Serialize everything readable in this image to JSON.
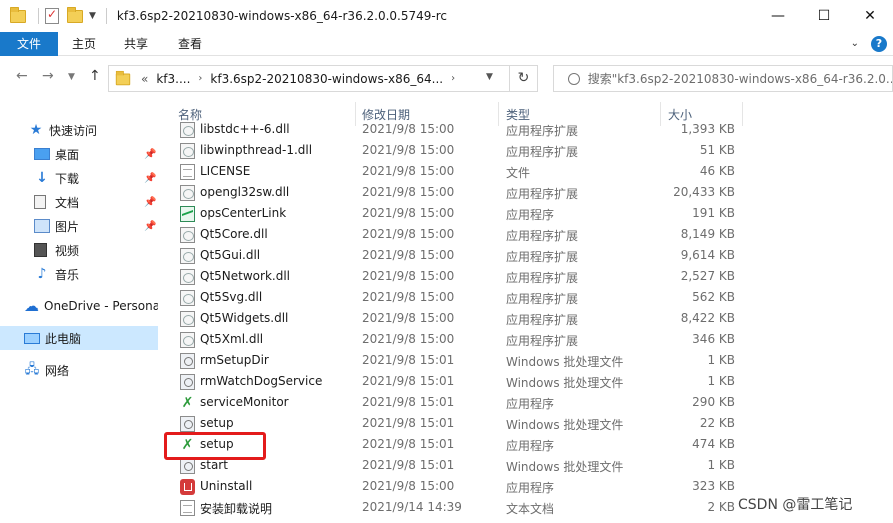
{
  "window": {
    "title": "kf3.6sp2-20210830-windows-x86_64-r36.2.0.0.5749-rc",
    "controls": {
      "minimize": "—",
      "maximize": "☐",
      "close": "✕"
    }
  },
  "ribbon": {
    "file_tab": "文件",
    "tabs": [
      "主页",
      "共享",
      "查看"
    ],
    "help": "?"
  },
  "address_bar": {
    "overflow": "«",
    "crumbs": [
      "kf3....",
      "kf3.6sp2-20210830-windows-x86_64..."
    ],
    "search_placeholder": "搜索\"kf3.6sp2-20210830-windows-x86_64-r36.2.0...."
  },
  "sidebar": {
    "items": [
      {
        "label": "快速访问",
        "icon": "star-icon",
        "pinned": false
      },
      {
        "label": "桌面",
        "icon": "desktop-icon",
        "pinned": true
      },
      {
        "label": "下载",
        "icon": "download-icon",
        "pinned": true
      },
      {
        "label": "文档",
        "icon": "documents-icon",
        "pinned": true
      },
      {
        "label": "图片",
        "icon": "pictures-icon",
        "pinned": true
      },
      {
        "label": "视频",
        "icon": "videos-icon",
        "pinned": false
      },
      {
        "label": "音乐",
        "icon": "music-icon",
        "pinned": false
      },
      {
        "label": "OneDrive - Persona",
        "icon": "onedrive-icon",
        "pinned": false
      },
      {
        "label": "此电脑",
        "icon": "pc-icon",
        "pinned": false,
        "selected": true
      },
      {
        "label": "网络",
        "icon": "network-icon",
        "pinned": false
      }
    ]
  },
  "columns": {
    "name": "名称",
    "date": "修改日期",
    "type": "类型",
    "size": "大小"
  },
  "files": [
    {
      "name": "libstdc++-6.dll",
      "date": "2021/9/8 15:00",
      "type": "应用程序扩展",
      "size": "1,393 KB",
      "icon": "dll"
    },
    {
      "name": "libwinpthread-1.dll",
      "date": "2021/9/8 15:00",
      "type": "应用程序扩展",
      "size": "51 KB",
      "icon": "dll"
    },
    {
      "name": "LICENSE",
      "date": "2021/9/8 15:00",
      "type": "文件",
      "size": "46 KB",
      "icon": "txt"
    },
    {
      "name": "opengl32sw.dll",
      "date": "2021/9/8 15:00",
      "type": "应用程序扩展",
      "size": "20,433 KB",
      "icon": "dll"
    },
    {
      "name": "opsCenterLink",
      "date": "2021/9/8 15:00",
      "type": "应用程序",
      "size": "191 KB",
      "icon": "exe-chart"
    },
    {
      "name": "Qt5Core.dll",
      "date": "2021/9/8 15:00",
      "type": "应用程序扩展",
      "size": "8,149 KB",
      "icon": "dll"
    },
    {
      "name": "Qt5Gui.dll",
      "date": "2021/9/8 15:00",
      "type": "应用程序扩展",
      "size": "9,614 KB",
      "icon": "dll"
    },
    {
      "name": "Qt5Network.dll",
      "date": "2021/9/8 15:00",
      "type": "应用程序扩展",
      "size": "2,527 KB",
      "icon": "dll"
    },
    {
      "name": "Qt5Svg.dll",
      "date": "2021/9/8 15:00",
      "type": "应用程序扩展",
      "size": "562 KB",
      "icon": "dll"
    },
    {
      "name": "Qt5Widgets.dll",
      "date": "2021/9/8 15:00",
      "type": "应用程序扩展",
      "size": "8,422 KB",
      "icon": "dll"
    },
    {
      "name": "Qt5Xml.dll",
      "date": "2021/9/8 15:00",
      "type": "应用程序扩展",
      "size": "346 KB",
      "icon": "dll"
    },
    {
      "name": "rmSetupDir",
      "date": "2021/9/8 15:01",
      "type": "Windows 批处理文件",
      "size": "1 KB",
      "icon": "bat"
    },
    {
      "name": "rmWatchDogService",
      "date": "2021/9/8 15:01",
      "type": "Windows 批处理文件",
      "size": "1 KB",
      "icon": "bat"
    },
    {
      "name": "serviceMonitor",
      "date": "2021/9/8 15:01",
      "type": "应用程序",
      "size": "290 KB",
      "icon": "exe-tool"
    },
    {
      "name": "setup",
      "date": "2021/9/8 15:01",
      "type": "Windows 批处理文件",
      "size": "22 KB",
      "icon": "bat"
    },
    {
      "name": "setup",
      "date": "2021/9/8 15:01",
      "type": "应用程序",
      "size": "474 KB",
      "icon": "exe-tool",
      "highlighted": true
    },
    {
      "name": "start",
      "date": "2021/9/8 15:01",
      "type": "Windows 批处理文件",
      "size": "1 KB",
      "icon": "bat"
    },
    {
      "name": "Uninstall",
      "date": "2021/9/8 15:00",
      "type": "应用程序",
      "size": "323 KB",
      "icon": "exe-uninstall"
    },
    {
      "name": "安装卸载说明",
      "date": "2021/9/14 14:39",
      "type": "文本文档",
      "size": "2 KB",
      "icon": "txt"
    }
  ],
  "highlight_color": "#e31b1b",
  "accent_color": "#1979ca",
  "watermark": "CSDN @雷工笔记"
}
